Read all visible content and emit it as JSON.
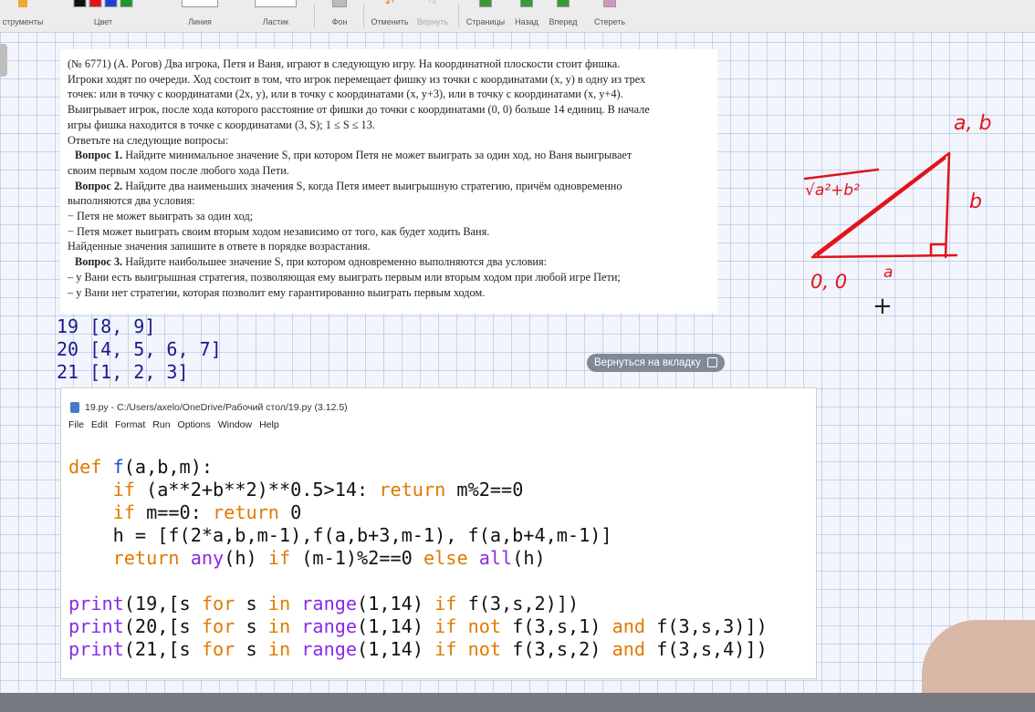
{
  "toolbar": {
    "groups": [
      {
        "label": "струменты"
      },
      {
        "label": "Цвет"
      },
      {
        "label": "Линия"
      },
      {
        "label": "Ластик"
      },
      {
        "label": "Фон"
      },
      {
        "label": "Отменить"
      },
      {
        "label": "Вернуть"
      },
      {
        "label": "Страницы"
      },
      {
        "label": "Назад"
      },
      {
        "label": "Вперед"
      },
      {
        "label": "Стереть"
      }
    ],
    "colors": [
      "#111111",
      "#e3121b",
      "#1f3fd1",
      "#1a9a2a"
    ]
  },
  "problem": {
    "lines": [
      "(№ 6771) (А. Рогов) Два игрока, Петя и Ваня, играют в следующую игру. На координатной плоскости стоит фишка.",
      "Игроки ходят по очереди. Ход состоит в том, что игрок перемещает фишку из точки с координатами (x, y) в одну из трех",
      "точек: или в точку с координатами (2x, y), или в точку с координатами (x, y+3), или в точку с координатами (x, y+4).",
      "Выигрывает игрок, после хода которого расстояние от фишки до точки с координатами (0, 0) больше 14 единиц. В начале",
      "игры фишка находится в точке с координатами (3, S); 1 ≤ S ≤ 13.",
      "Ответьте на следующие вопросы:"
    ],
    "q1_label": "Вопрос 1.",
    "q1_text": " Найдите минимальное значение S, при котором Петя не может выиграть за один ход, но Ваня выигрывает",
    "q1_cont": "своим первым ходом после любого хода Пети.",
    "q2_label": "Вопрос 2.",
    "q2_text": " Найдите два наименьших значения S, когда Петя имеет выигрышную стратегию, причём одновременно",
    "q2_lines": [
      "выполняются два условия:",
      "− Петя не может выиграть за один ход;",
      "− Петя может выиграть своим вторым ходом независимо от того, как будет ходить Ваня.",
      "Найденные значения запишите в ответе в порядке возрастания."
    ],
    "q3_label": "Вопрос 3.",
    "q3_text": " Найдите наибольшее значение S, при котором одновременно выполняются два условия:",
    "q3_lines": [
      "– у Вани есть выигрышная стратегия, позволяющая ему выиграть первым или вторым ходом при любой игре Пети;",
      "– у Вани нет стратегии, которая позволит ему гарантированно выиграть первым ходом."
    ]
  },
  "output": [
    "19 [8, 9]",
    "20 [4, 5, 6, 7]",
    "21 [1, 2, 3]"
  ],
  "return_tab": {
    "label": "Вернуться на вкладку"
  },
  "idle": {
    "title": "19.py - C:/Users/axelo/OneDrive/Рабочий стол/19.py (3.12.5)",
    "menu": [
      "File",
      "Edit",
      "Format",
      "Run",
      "Options",
      "Window",
      "Help"
    ]
  },
  "sketch": {
    "label_ab": "a, b",
    "label_hyp": "√a²+b²",
    "label_b": "b",
    "label_a": "a",
    "label_origin": "0, 0",
    "cursor": "+"
  }
}
